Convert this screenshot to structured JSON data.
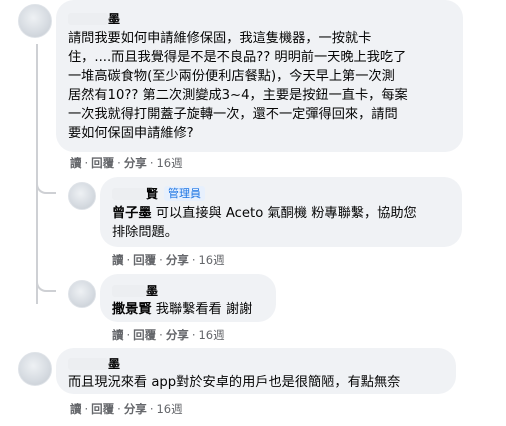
{
  "comments": [
    {
      "author_suffix": "墨",
      "text": "請問我要如何申請維修保固，我這隻機器，一按就卡\n住，....而且我覺得是不是不良品?? 明明前一天晚上我吃了\n一堆高碳食物(至少兩份便利店餐點)，今天早上第一次測\n居然有10?? 第二次測變成3~4，主要是按鈕一直卡，每案\n一次我就得打開蓋子旋轉一次，還不一定彈得回來，請問\n要如何保固申請維修?",
      "actions": {
        "read": "讀",
        "reply": "回覆",
        "share": "分享",
        "time": "16週"
      }
    },
    {
      "author_suffix": "賢",
      "badge": "管理員",
      "mention": "曾子墨",
      "text": " 可以直接與 Aceto 氣酮機 粉專聯繫，協助您\n排除問題。",
      "actions": {
        "read": "讀",
        "reply": "回覆",
        "share": "分享",
        "time": "16週"
      }
    },
    {
      "author_suffix": "墨",
      "mention": "撒景賢",
      "text": " 我聯繫看看 謝謝",
      "actions": {
        "read": "讀",
        "reply": "回覆",
        "share": "分享",
        "time": "16週"
      }
    },
    {
      "author_suffix": "墨",
      "text": "而且現況來看 app對於安卓的用戶也是很簡陋，有點無奈",
      "actions": {
        "read": "讀",
        "reply": "回覆",
        "share": "分享",
        "time": "16週"
      }
    }
  ],
  "separator": "·"
}
